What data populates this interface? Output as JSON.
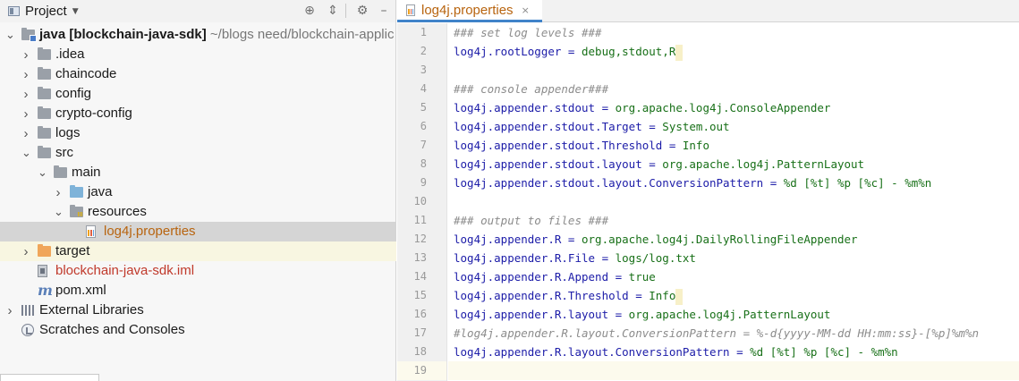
{
  "project_panel": {
    "title": "Project",
    "toolbar": {
      "locate_icon": "crosshair-icon",
      "collapse_icon": "collapse-all-icon",
      "settings_icon": "gear-icon",
      "hide_icon": "minimize-icon"
    },
    "tree": [
      {
        "indent": 0,
        "expanded": true,
        "icon": "module-folder",
        "bold": "java [blockchain-java-sdk]",
        "path": " ~/blogs need/blockchain-applic"
      },
      {
        "indent": 1,
        "expanded": false,
        "icon": "folder",
        "label": ".idea"
      },
      {
        "indent": 1,
        "expanded": false,
        "icon": "folder",
        "label": "chaincode"
      },
      {
        "indent": 1,
        "expanded": false,
        "icon": "folder",
        "label": "config"
      },
      {
        "indent": 1,
        "expanded": false,
        "icon": "folder",
        "label": "crypto-config"
      },
      {
        "indent": 1,
        "expanded": false,
        "icon": "folder",
        "label": "logs"
      },
      {
        "indent": 1,
        "expanded": true,
        "icon": "folder",
        "label": "src"
      },
      {
        "indent": 2,
        "expanded": true,
        "icon": "folder",
        "label": "main"
      },
      {
        "indent": 3,
        "expanded": false,
        "icon": "folder-blue",
        "label": "java"
      },
      {
        "indent": 3,
        "expanded": true,
        "icon": "folder-resources",
        "label": "resources"
      },
      {
        "indent": 4,
        "expanded": null,
        "icon": "properties-file",
        "label": "log4j.properties",
        "color": "orange",
        "selected": true
      },
      {
        "indent": 1,
        "expanded": false,
        "icon": "folder-orange",
        "label": "target",
        "highlight": true
      },
      {
        "indent": 1,
        "expanded": null,
        "icon": "iml-file",
        "label": "blockchain-java-sdk.iml",
        "color": "red"
      },
      {
        "indent": 1,
        "expanded": null,
        "icon": "maven-file",
        "label": "pom.xml"
      },
      {
        "indent": 0,
        "expanded": false,
        "icon": "libraries",
        "label": "External Libraries"
      },
      {
        "indent": 0,
        "expanded": null,
        "icon": "scratches",
        "label": "Scratches and Consoles"
      }
    ]
  },
  "editor": {
    "tab": {
      "title": "log4j.properties",
      "close": "×"
    },
    "lines": [
      {
        "n": "1",
        "parts": [
          {
            "c": "### set log levels ###"
          }
        ]
      },
      {
        "n": "2",
        "parts": [
          {
            "k": "log4j.rootLogger = "
          },
          {
            "v": "debug,stdout,R"
          }
        ],
        "caret": true
      },
      {
        "n": "3",
        "parts": []
      },
      {
        "n": "4",
        "parts": [
          {
            "c": "### console appender###"
          }
        ]
      },
      {
        "n": "5",
        "parts": [
          {
            "k": "log4j.appender.stdout = "
          },
          {
            "v": "org.apache.log4j.ConsoleAppender"
          }
        ]
      },
      {
        "n": "6",
        "parts": [
          {
            "k": "log4j.appender.stdout.Target = "
          },
          {
            "v": "System.out"
          }
        ]
      },
      {
        "n": "7",
        "parts": [
          {
            "k": "log4j.appender.stdout.Threshold = "
          },
          {
            "v": "Info"
          }
        ]
      },
      {
        "n": "8",
        "parts": [
          {
            "k": "log4j.appender.stdout.layout = "
          },
          {
            "v": "org.apache.log4j.PatternLayout"
          }
        ]
      },
      {
        "n": "9",
        "parts": [
          {
            "k": "log4j.appender.stdout.layout.ConversionPattern = "
          },
          {
            "v": "%d [%t] %p [%c] - %m%n"
          }
        ]
      },
      {
        "n": "10",
        "parts": []
      },
      {
        "n": "11",
        "parts": [
          {
            "c": "### output to files ###"
          }
        ]
      },
      {
        "n": "12",
        "parts": [
          {
            "k": "log4j.appender.R = "
          },
          {
            "v": "org.apache.log4j.DailyRollingFileAppender"
          }
        ]
      },
      {
        "n": "13",
        "parts": [
          {
            "k": "log4j.appender.R.File = "
          },
          {
            "v": "logs/log.txt"
          }
        ]
      },
      {
        "n": "14",
        "parts": [
          {
            "k": "log4j.appender.R.Append = "
          },
          {
            "v": "true"
          }
        ]
      },
      {
        "n": "15",
        "parts": [
          {
            "k": "log4j.appender.R.Threshold = "
          },
          {
            "v": "Info"
          }
        ],
        "caret": true
      },
      {
        "n": "16",
        "parts": [
          {
            "k": "log4j.appender.R.layout = "
          },
          {
            "v": "org.apache.log4j.PatternLayout"
          }
        ]
      },
      {
        "n": "17",
        "parts": [
          {
            "c": "#log4j.appender.R.layout.ConversionPattern = %-d{yyyy-MM-dd HH:mm:ss}-[%p]%m%n"
          }
        ]
      },
      {
        "n": "18",
        "parts": [
          {
            "k": "log4j.appender.R.layout.ConversionPattern = "
          },
          {
            "v": "%d [%t] %p [%c] - %m%n"
          }
        ]
      },
      {
        "n": "19",
        "parts": [],
        "current": true
      }
    ]
  }
}
